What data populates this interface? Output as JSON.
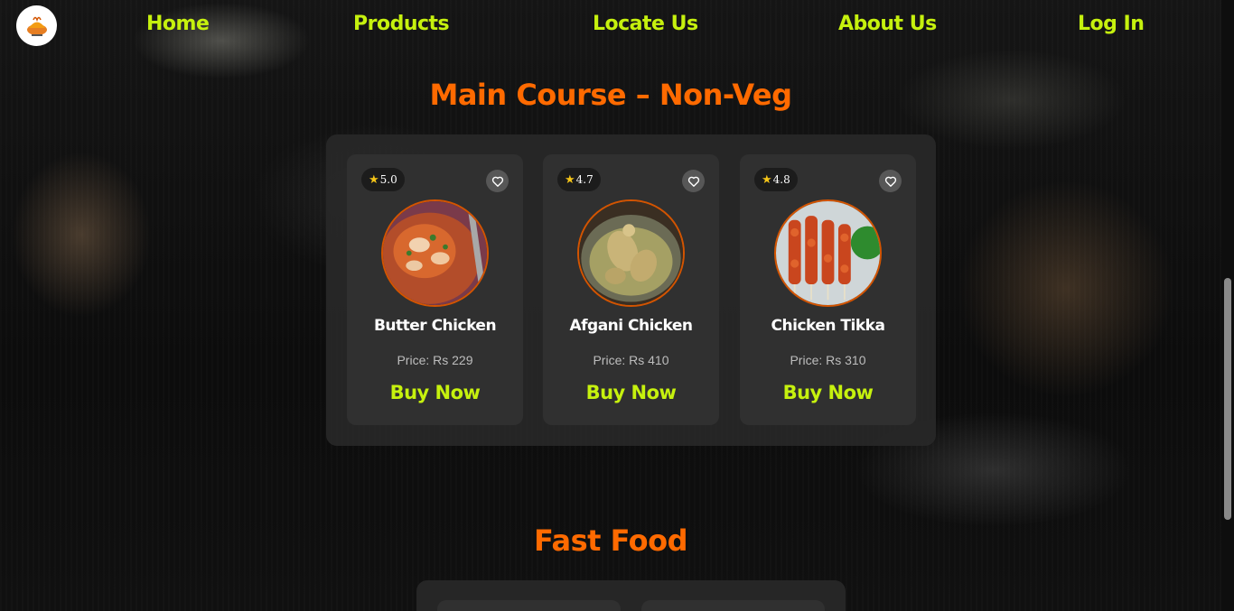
{
  "nav": {
    "logo_icon": "logo-icon",
    "links": [
      "Home",
      "Products",
      "Locate Us",
      "About Us",
      "Log In"
    ]
  },
  "sections": {
    "main_course_title": "Main Course – Non-Veg",
    "fast_food_title": "Fast Food"
  },
  "products": [
    {
      "rating": "5.0",
      "name": "Butter Chicken",
      "price": "Price: Rs 229",
      "buy_label": "Buy Now"
    },
    {
      "rating": "4.7",
      "name": "Afgani Chicken",
      "price": "Price: Rs 410",
      "buy_label": "Buy Now"
    },
    {
      "rating": "4.8",
      "name": "Chicken Tikka",
      "price": "Price: Rs 310",
      "buy_label": "Buy Now"
    }
  ],
  "colors": {
    "accent_green": "#c6f10e",
    "title_orange": "#ff6a00",
    "star_yellow": "#f5c518"
  }
}
